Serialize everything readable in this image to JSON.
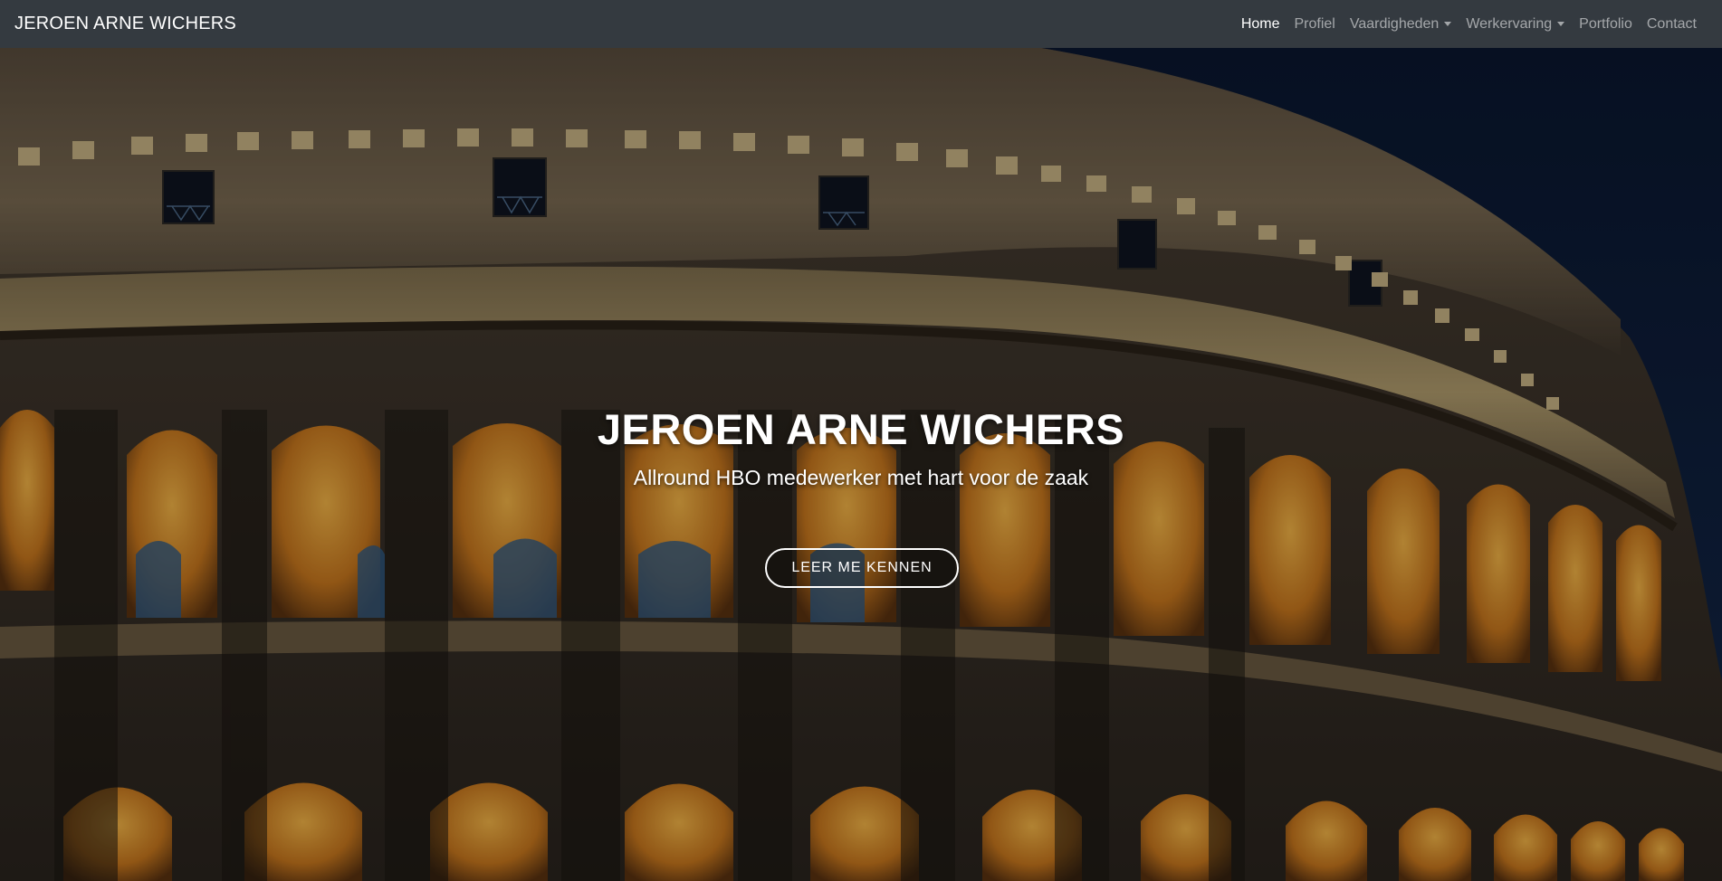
{
  "navbar": {
    "brand": "JEROEN ARNE WICHERS",
    "items": [
      {
        "label": "Home",
        "active": true,
        "dropdown": false
      },
      {
        "label": "Profiel",
        "active": false,
        "dropdown": false
      },
      {
        "label": "Vaardigheden",
        "active": false,
        "dropdown": true
      },
      {
        "label": "Werkervaring",
        "active": false,
        "dropdown": true
      },
      {
        "label": "Portfolio",
        "active": false,
        "dropdown": false
      },
      {
        "label": "Contact",
        "active": false,
        "dropdown": false
      }
    ]
  },
  "hero": {
    "title": "JEROEN ARNE WICHERS",
    "subtitle": "Allround HBO medewerker met hart voor de zaak",
    "button_label": "LEER ME KENNEN"
  },
  "colors": {
    "navbar_bg": "#343a40",
    "sky": "#0c1a33",
    "stone": "#6b5a44",
    "arch_light": "#e59a2e"
  },
  "icons": {
    "dropdown": "caret-down-icon"
  }
}
